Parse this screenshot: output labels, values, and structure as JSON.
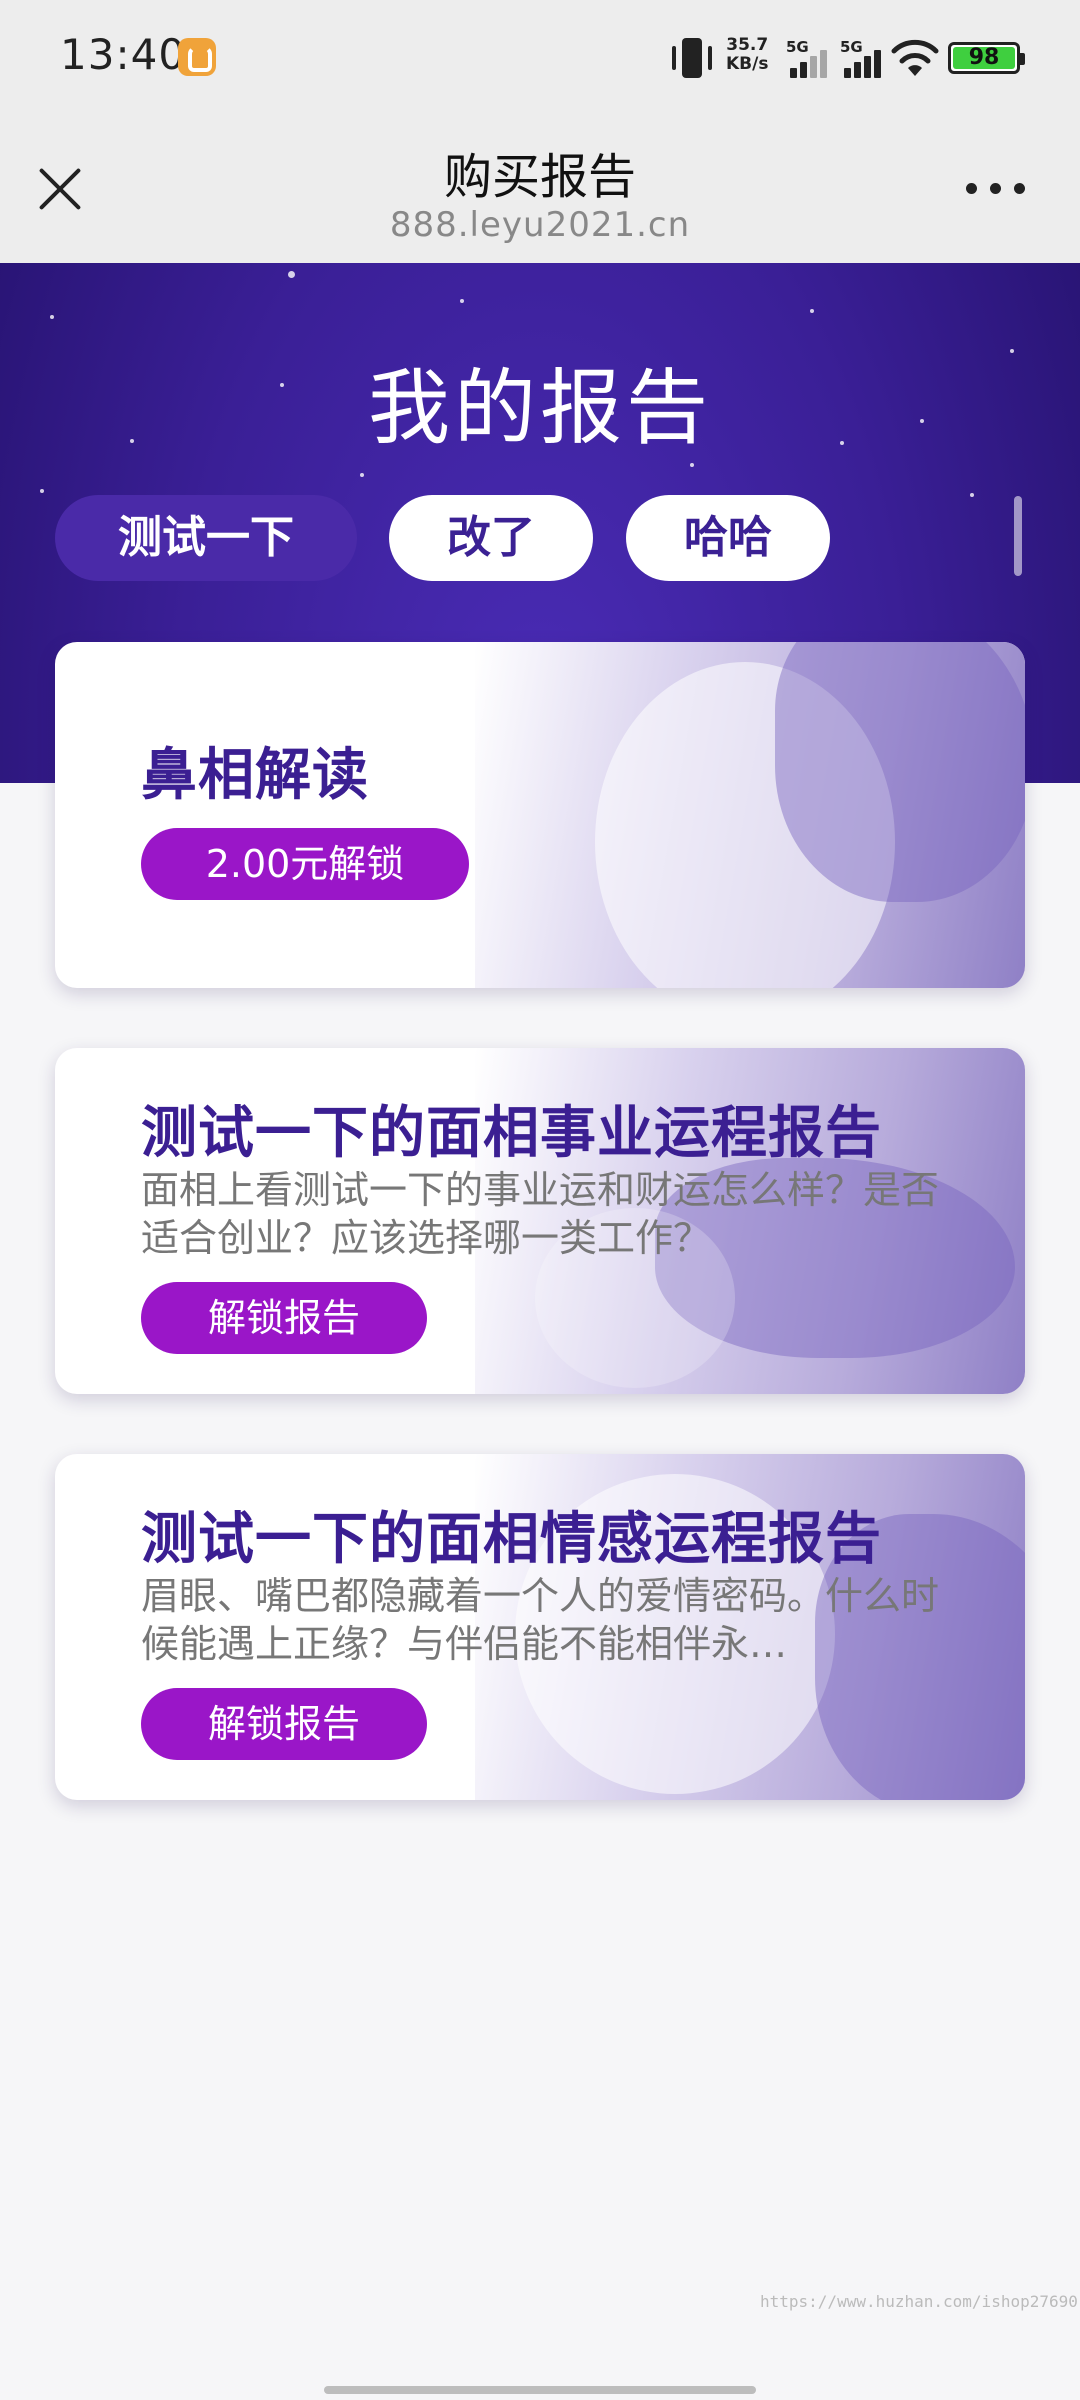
{
  "status_bar": {
    "time": "13:40",
    "net_speed_value": "35.7",
    "net_speed_unit": "KB/s",
    "signal_1_tag": "5G",
    "signal_2_tag": "5G",
    "battery": "98",
    "icons": [
      "app-notification-icon",
      "vibrate-icon",
      "signal-icon",
      "wifi-icon",
      "battery-icon"
    ]
  },
  "title_bar": {
    "title": "购买报告",
    "url": "888.leyu2021.cn",
    "close_icon": "close-icon",
    "more_icon": "more-icon"
  },
  "hero": {
    "title": "我的报告"
  },
  "tabs": [
    {
      "label": "测试一下",
      "active": true
    },
    {
      "label": "改了",
      "active": false
    },
    {
      "label": "哈哈",
      "active": false
    }
  ],
  "cards": [
    {
      "title": "鼻相解读",
      "button": "2.00元解锁"
    },
    {
      "title": "测试一下的面相事业运程报告",
      "description": "面相上看测试一下的事业运和财运怎么样？是否适合创业？应该选择哪一类工作？",
      "button": "解锁报告"
    },
    {
      "title": "测试一下的面相情感运程报告",
      "description": "眉眼、嘴巴都隐藏着一个人的爱情密码。什么时候能遇上正缘？与伴侣能不能相伴永…",
      "button": "解锁报告"
    }
  ],
  "watermark": "https://www.huzhan.com/ishop27690",
  "colors": {
    "accent_purple": "#3b1f92",
    "button_purple": "#9a16c8",
    "tab_active": "#4a2aa8"
  }
}
